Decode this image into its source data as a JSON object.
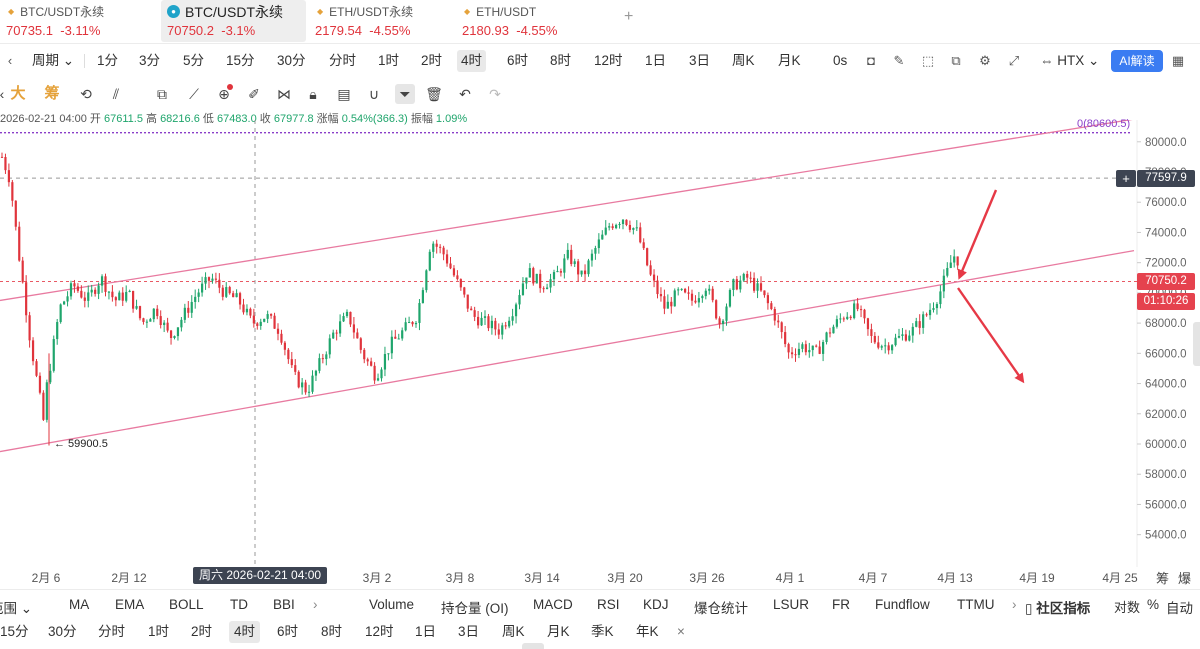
{
  "market_tabs": [
    {
      "symbol": "BTC/USDT永续",
      "price": "70735.1",
      "change": "-3.11%"
    },
    {
      "symbol": "BTC/USDT永续",
      "price": "70750.2",
      "change": "-3.1%",
      "active": true
    },
    {
      "symbol": "ETH/USDT永续",
      "price": "2179.54",
      "change": "-4.55%"
    },
    {
      "symbol": "ETH/USDT",
      "price": "2180.93",
      "change": "-4.55%"
    }
  ],
  "add_tab": "+",
  "interval_toolbar": {
    "period_label": "周期",
    "intervals": [
      "1分",
      "3分",
      "5分",
      "15分",
      "30分",
      "分时",
      "1时",
      "2时",
      "4时",
      "6时",
      "8时",
      "12时",
      "1日",
      "3日",
      "周K",
      "月K"
    ],
    "active_interval": "4时",
    "countdown": "0s",
    "exchange": "HTX",
    "ai_label": "AI解读"
  },
  "draw_toolbar": {
    "text_tool_1": "大",
    "text_tool_2": "筹"
  },
  "info_line": {
    "datetime": "2026-02-21 04:00",
    "open_label": "开",
    "open": "67611.5",
    "high_label": "高",
    "high": "68216.6",
    "low_label": "低",
    "low": "67483.0",
    "close_label": "收",
    "close": "67977.8",
    "change_label": "涨幅",
    "change": "0.54%(366.3)",
    "amplitude_label": "振幅",
    "amplitude": "1.09%"
  },
  "price_tags": {
    "current": "70750.2",
    "timer": "01:10:26",
    "hover": "77597.9",
    "plus": "+",
    "horizontal_line_label": "0(80600.5)",
    "low_label": "← 59900.5"
  },
  "x_axis": {
    "labels": [
      "2月 6",
      "2月 12",
      "3月 2",
      "3月 8",
      "3月 14",
      "3月 20",
      "3月 26",
      "4月 1",
      "4月 7",
      "4月 13",
      "4月 19",
      "4月 25"
    ],
    "crosshair_label": "周六 2026-02-21 04:00",
    "corner_1": "筹",
    "corner_2": "爆"
  },
  "indicators": {
    "range_label": "范围",
    "main": [
      "MA",
      "EMA",
      "BOLL",
      "TD",
      "BBI"
    ],
    "sub": [
      "Volume",
      "持仓量 (OI)",
      "MACD",
      "RSI",
      "KDJ",
      "爆仓统计",
      "LSUR",
      "FR",
      "Fundflow",
      "TTMU"
    ],
    "community": "社区指标",
    "log_label": "对数",
    "percent_label": "%",
    "auto_label": "自动"
  },
  "bottom_periods": {
    "items": [
      "15分",
      "30分",
      "分时",
      "1时",
      "2时",
      "4时",
      "6时",
      "8时",
      "12时",
      "1日",
      "3日",
      "周K",
      "月K",
      "季K",
      "年K"
    ],
    "active": "4时",
    "close": "×"
  },
  "colors": {
    "up": "#1fa56c",
    "down": "#e0343c",
    "channel": "#e87aa0",
    "arrow": "#e63946",
    "dotted_line": "#8a3ec9"
  },
  "chart_data": {
    "type": "candlestick",
    "symbol": "BTC/USDT永续",
    "interval": "4时",
    "ylim": [
      52500,
      82000
    ],
    "y_ticks": [
      54000,
      56000,
      58000,
      60000,
      62000,
      64000,
      66000,
      68000,
      70000,
      72000,
      74000,
      76000,
      78000,
      80000
    ],
    "x_tick_labels": [
      "2月 6",
      "2月 12",
      "3月 2",
      "3月 8",
      "3月 14",
      "3月 20",
      "3月 26",
      "4月 1",
      "4月 7",
      "4月 13",
      "4月 19",
      "4月 25"
    ],
    "current_price": 70750.2,
    "hover_price": 77597.9,
    "horizontal_line": 80600.5,
    "period_low": 59900.5,
    "trend_path": [
      [
        "02-02",
        79000
      ],
      [
        "02-03",
        77500
      ],
      [
        "02-04",
        73000
      ],
      [
        "02-05",
        67000
      ],
      [
        "02-06",
        60500
      ],
      [
        "02-06",
        63500
      ],
      [
        "02-07",
        69000
      ],
      [
        "02-08",
        70500
      ],
      [
        "02-09",
        69500
      ],
      [
        "02-10",
        71000
      ],
      [
        "02-11",
        69500
      ],
      [
        "02-12",
        70000
      ],
      [
        "02-13",
        68000
      ],
      [
        "02-14",
        69000
      ],
      [
        "02-15",
        67000
      ],
      [
        "02-16",
        68500
      ],
      [
        "02-17",
        70000
      ],
      [
        "02-18",
        71000
      ],
      [
        "02-19",
        70000
      ],
      [
        "02-20",
        69500
      ],
      [
        "02-21",
        68000
      ],
      [
        "02-22",
        68500
      ],
      [
        "02-23",
        67500
      ],
      [
        "02-24",
        64500
      ],
      [
        "02-25",
        63500
      ],
      [
        "02-26",
        65500
      ],
      [
        "02-27",
        67500
      ],
      [
        "02-28",
        68500
      ],
      [
        "03-01",
        66000
      ],
      [
        "03-02",
        64500
      ],
      [
        "03-03",
        66500
      ],
      [
        "03-04",
        67500
      ],
      [
        "03-05",
        68500
      ],
      [
        "03-06",
        73500
      ],
      [
        "03-07",
        72500
      ],
      [
        "03-08",
        70500
      ],
      [
        "03-09",
        68500
      ],
      [
        "03-10",
        68000
      ],
      [
        "03-11",
        67500
      ],
      [
        "03-12",
        69000
      ],
      [
        "03-13",
        71500
      ],
      [
        "03-14",
        70500
      ],
      [
        "03-15",
        71000
      ],
      [
        "03-16",
        72500
      ],
      [
        "03-17",
        71000
      ],
      [
        "03-18",
        73000
      ],
      [
        "03-19",
        74500
      ],
      [
        "03-20",
        75000
      ],
      [
        "03-21",
        74000
      ],
      [
        "03-22",
        71000
      ],
      [
        "03-23",
        69000
      ],
      [
        "03-24",
        70000
      ],
      [
        "03-25",
        69500
      ],
      [
        "03-26",
        70500
      ],
      [
        "03-27",
        68000
      ],
      [
        "03-28",
        70500
      ],
      [
        "03-29",
        71000
      ],
      [
        "03-30",
        70000
      ],
      [
        "03-31",
        68500
      ],
      [
        "04-01",
        66000
      ],
      [
        "04-02",
        66500
      ],
      [
        "04-03",
        66000
      ],
      [
        "04-04",
        67500
      ],
      [
        "04-05",
        68500
      ],
      [
        "04-06",
        69000
      ],
      [
        "04-07",
        67000
      ],
      [
        "04-08",
        66500
      ],
      [
        "04-09",
        67000
      ],
      [
        "04-10",
        67500
      ],
      [
        "04-11",
        68500
      ],
      [
        "04-12",
        70000
      ],
      [
        "04-13",
        72500
      ],
      [
        "04-14",
        71500
      ],
      [
        "04-15",
        72000
      ],
      [
        "04-16",
        73000
      ],
      [
        "04-17",
        73500
      ],
      [
        "04-18",
        71000
      ],
      [
        "04-19",
        70750
      ]
    ],
    "annotations": [
      {
        "type": "parallel_channel",
        "upper": [
          [
            "02-02",
            69500
          ],
          [
            "04-25",
            81500
          ]
        ],
        "lower": [
          [
            "02-02",
            59500
          ],
          [
            "04-25",
            72800
          ]
        ]
      },
      {
        "type": "arrow",
        "direction": "down",
        "desc": "arrow pointing to price near lower channel line"
      },
      {
        "type": "arrow",
        "direction": "down-right",
        "desc": "projected breakdown arrow"
      }
    ],
    "grid": false
  }
}
